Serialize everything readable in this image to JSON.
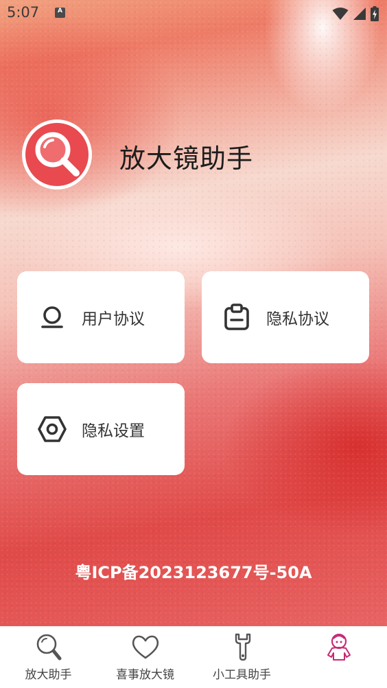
{
  "status_bar": {
    "time": "5:07",
    "notification_icon": "a-letter-icon",
    "icons": [
      "wifi-icon",
      "signal-icon",
      "battery-charging-icon"
    ]
  },
  "app": {
    "title": "放大镜助手",
    "logo_icon": "magnifier-icon"
  },
  "cards": [
    {
      "label": "用户协议",
      "icon": "user-icon"
    },
    {
      "label": "隐私协议",
      "icon": "clipboard-icon"
    },
    {
      "label": "隐私设置",
      "icon": "hex-settings-icon"
    }
  ],
  "footer": {
    "icp": "粤ICP备2023123677号-50A"
  },
  "bottom_nav": {
    "items": [
      {
        "label": "放大助手",
        "icon": "magnifier-icon"
      },
      {
        "label": "喜事放大镜",
        "icon": "heart-icon"
      },
      {
        "label": "小工具助手",
        "icon": "wrench-icon"
      },
      {
        "label": "",
        "icon": "character-icon",
        "active": true
      }
    ]
  },
  "colors": {
    "accent": "#e84a4f",
    "active_tab": "#c62a75",
    "card_bg": "#ffffff"
  }
}
